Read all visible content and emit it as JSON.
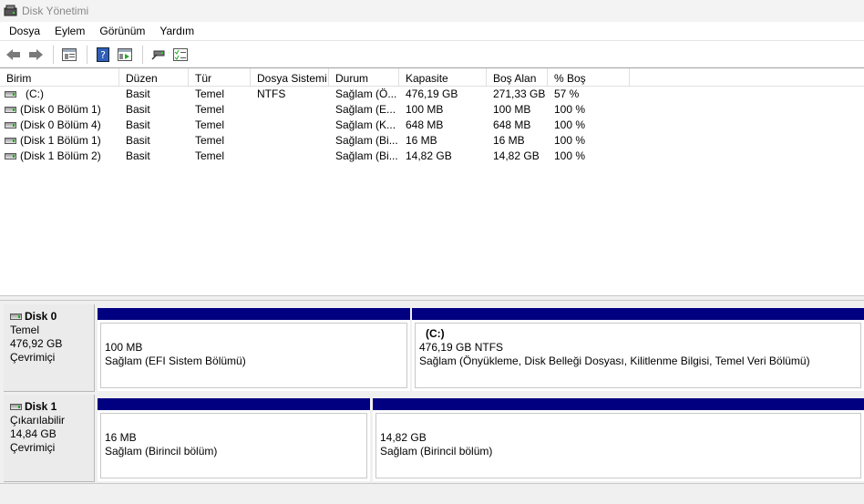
{
  "window": {
    "title": "Disk Yönetimi"
  },
  "menu": [
    "Dosya",
    "Eylem",
    "Görünüm",
    "Yardım"
  ],
  "toolbar": {
    "buttons": [
      "back-arrow-icon",
      "forward-arrow-icon",
      "properties-icon",
      "help-icon",
      "view-icon",
      "connect-icon",
      "checklist-icon"
    ]
  },
  "volumes": {
    "columns": [
      "Birim",
      "Düzen",
      "Tür",
      "Dosya Sistemi",
      "Durum",
      "Kapasite",
      "Boş Alan",
      "% Boş"
    ],
    "rows": [
      [
        "(C:)",
        "Basit",
        "Temel",
        "NTFS",
        "Sağlam (Ö...",
        "476,19 GB",
        "271,33 GB",
        "57 %"
      ],
      [
        "(Disk 0 Bölüm 1)",
        "Basit",
        "Temel",
        "",
        "Sağlam (E...",
        "100 MB",
        "100 MB",
        "100 %"
      ],
      [
        "(Disk 0 Bölüm 4)",
        "Basit",
        "Temel",
        "",
        "Sağlam (K...",
        "648 MB",
        "648 MB",
        "100 %"
      ],
      [
        "(Disk 1 Bölüm 1)",
        "Basit",
        "Temel",
        "",
        "Sağlam (Bi...",
        "16 MB",
        "16 MB",
        "100 %"
      ],
      [
        "(Disk 1 Bölüm 2)",
        "Basit",
        "Temel",
        "",
        "Sağlam (Bi...",
        "14,82 GB",
        "14,82 GB",
        "100 %"
      ]
    ]
  },
  "disks": [
    {
      "name": "Disk 0",
      "type": "Temel",
      "size": "476,92 GB",
      "status": "Çevrimiçi",
      "partitions": [
        {
          "title": "",
          "size": "100 MB",
          "status": "Sağlam (EFI Sistem Bölümü)"
        },
        {
          "title": "(C:)",
          "size": "476,19 GB NTFS",
          "status": "Sağlam (Önyükleme, Disk Belleği Dosyası, Kilitlenme Bilgisi, Temel Veri Bölümü)"
        }
      ]
    },
    {
      "name": "Disk 1",
      "type": "Çıkarılabilir",
      "size": "14,84 GB",
      "status": "Çevrimiçi",
      "partitions": [
        {
          "title": "",
          "size": "16 MB",
          "status": "Sağlam (Birincil bölüm)"
        },
        {
          "title": "",
          "size": "14,82 GB",
          "status": "Sağlam (Birincil bölüm)"
        }
      ]
    }
  ],
  "colors": {
    "partition_bar": "#000080"
  }
}
